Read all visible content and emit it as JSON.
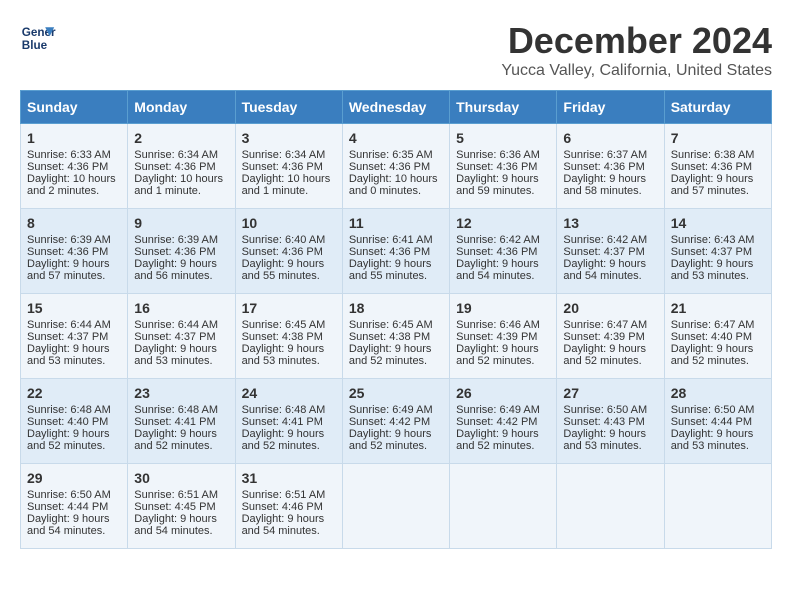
{
  "header": {
    "logo_line1": "General",
    "logo_line2": "Blue",
    "month": "December 2024",
    "location": "Yucca Valley, California, United States"
  },
  "days_of_week": [
    "Sunday",
    "Monday",
    "Tuesday",
    "Wednesday",
    "Thursday",
    "Friday",
    "Saturday"
  ],
  "weeks": [
    [
      {
        "day": 1,
        "sunrise": "6:33 AM",
        "sunset": "4:36 PM",
        "daylight": "10 hours and 2 minutes."
      },
      {
        "day": 2,
        "sunrise": "6:34 AM",
        "sunset": "4:36 PM",
        "daylight": "10 hours and 1 minute."
      },
      {
        "day": 3,
        "sunrise": "6:34 AM",
        "sunset": "4:36 PM",
        "daylight": "10 hours and 1 minute."
      },
      {
        "day": 4,
        "sunrise": "6:35 AM",
        "sunset": "4:36 PM",
        "daylight": "10 hours and 0 minutes."
      },
      {
        "day": 5,
        "sunrise": "6:36 AM",
        "sunset": "4:36 PM",
        "daylight": "9 hours and 59 minutes."
      },
      {
        "day": 6,
        "sunrise": "6:37 AM",
        "sunset": "4:36 PM",
        "daylight": "9 hours and 58 minutes."
      },
      {
        "day": 7,
        "sunrise": "6:38 AM",
        "sunset": "4:36 PM",
        "daylight": "9 hours and 57 minutes."
      }
    ],
    [
      {
        "day": 8,
        "sunrise": "6:39 AM",
        "sunset": "4:36 PM",
        "daylight": "9 hours and 57 minutes."
      },
      {
        "day": 9,
        "sunrise": "6:39 AM",
        "sunset": "4:36 PM",
        "daylight": "9 hours and 56 minutes."
      },
      {
        "day": 10,
        "sunrise": "6:40 AM",
        "sunset": "4:36 PM",
        "daylight": "9 hours and 55 minutes."
      },
      {
        "day": 11,
        "sunrise": "6:41 AM",
        "sunset": "4:36 PM",
        "daylight": "9 hours and 55 minutes."
      },
      {
        "day": 12,
        "sunrise": "6:42 AM",
        "sunset": "4:36 PM",
        "daylight": "9 hours and 54 minutes."
      },
      {
        "day": 13,
        "sunrise": "6:42 AM",
        "sunset": "4:37 PM",
        "daylight": "9 hours and 54 minutes."
      },
      {
        "day": 14,
        "sunrise": "6:43 AM",
        "sunset": "4:37 PM",
        "daylight": "9 hours and 53 minutes."
      }
    ],
    [
      {
        "day": 15,
        "sunrise": "6:44 AM",
        "sunset": "4:37 PM",
        "daylight": "9 hours and 53 minutes."
      },
      {
        "day": 16,
        "sunrise": "6:44 AM",
        "sunset": "4:37 PM",
        "daylight": "9 hours and 53 minutes."
      },
      {
        "day": 17,
        "sunrise": "6:45 AM",
        "sunset": "4:38 PM",
        "daylight": "9 hours and 53 minutes."
      },
      {
        "day": 18,
        "sunrise": "6:45 AM",
        "sunset": "4:38 PM",
        "daylight": "9 hours and 52 minutes."
      },
      {
        "day": 19,
        "sunrise": "6:46 AM",
        "sunset": "4:39 PM",
        "daylight": "9 hours and 52 minutes."
      },
      {
        "day": 20,
        "sunrise": "6:47 AM",
        "sunset": "4:39 PM",
        "daylight": "9 hours and 52 minutes."
      },
      {
        "day": 21,
        "sunrise": "6:47 AM",
        "sunset": "4:40 PM",
        "daylight": "9 hours and 52 minutes."
      }
    ],
    [
      {
        "day": 22,
        "sunrise": "6:48 AM",
        "sunset": "4:40 PM",
        "daylight": "9 hours and 52 minutes."
      },
      {
        "day": 23,
        "sunrise": "6:48 AM",
        "sunset": "4:41 PM",
        "daylight": "9 hours and 52 minutes."
      },
      {
        "day": 24,
        "sunrise": "6:48 AM",
        "sunset": "4:41 PM",
        "daylight": "9 hours and 52 minutes."
      },
      {
        "day": 25,
        "sunrise": "6:49 AM",
        "sunset": "4:42 PM",
        "daylight": "9 hours and 52 minutes."
      },
      {
        "day": 26,
        "sunrise": "6:49 AM",
        "sunset": "4:42 PM",
        "daylight": "9 hours and 52 minutes."
      },
      {
        "day": 27,
        "sunrise": "6:50 AM",
        "sunset": "4:43 PM",
        "daylight": "9 hours and 53 minutes."
      },
      {
        "day": 28,
        "sunrise": "6:50 AM",
        "sunset": "4:44 PM",
        "daylight": "9 hours and 53 minutes."
      }
    ],
    [
      {
        "day": 29,
        "sunrise": "6:50 AM",
        "sunset": "4:44 PM",
        "daylight": "9 hours and 54 minutes."
      },
      {
        "day": 30,
        "sunrise": "6:51 AM",
        "sunset": "4:45 PM",
        "daylight": "9 hours and 54 minutes."
      },
      {
        "day": 31,
        "sunrise": "6:51 AM",
        "sunset": "4:46 PM",
        "daylight": "9 hours and 54 minutes."
      },
      null,
      null,
      null,
      null
    ]
  ]
}
